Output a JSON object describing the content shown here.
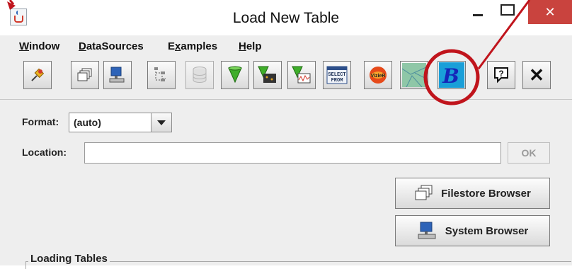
{
  "window": {
    "title": "Load New Table",
    "minimize_glyph": "–",
    "close_glyph": "✕"
  },
  "menubar": {
    "items": [
      {
        "mnemonic": "W",
        "rest": "indow"
      },
      {
        "mnemonic": "D",
        "rest": "ataSources"
      },
      {
        "pre": "E",
        "mnemonic": "x",
        "rest": "amples"
      },
      {
        "mnemonic": "H",
        "rest": "elp"
      }
    ]
  },
  "toolbar": {
    "select_from_line1": "SELECT",
    "select_from_line2": "FROM",
    "vizier_text": "VizieR",
    "b_text": "B",
    "help_glyph": "?",
    "close_glyph": "✕",
    "icons": [
      "pushpin-icon",
      "filestore-icon",
      "system-browser-icon",
      "tree-icon",
      "database-icon",
      "cone-search-icon",
      "cone-search-image-icon",
      "cone-search-spectrum-icon",
      "tap-query-icon",
      "vizier-icon",
      "sky-map-icon",
      "b-icon",
      "help-icon",
      "close-icon"
    ]
  },
  "form": {
    "format_label": "Format:",
    "format_value": "(auto)",
    "location_label": "Location:",
    "location_value": "",
    "ok_label": "OK"
  },
  "buttons": {
    "filestore": "Filestore Browser",
    "system": "System Browser"
  },
  "group": {
    "title": "Loading Tables"
  },
  "colors": {
    "annotation_red": "#c0141c",
    "close_red": "#c9433e",
    "panel_gray": "#eeeeee"
  }
}
